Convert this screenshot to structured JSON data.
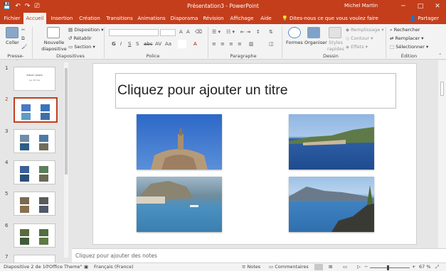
{
  "window": {
    "title": "Présentation3 - PowerPoint",
    "user": "Michel Martin",
    "controls": [
      "─",
      "□",
      "✕"
    ]
  },
  "qat": [
    "💾",
    "↶",
    "↷",
    "⎚"
  ],
  "tabs": [
    {
      "label": "Fichier"
    },
    {
      "label": "Accueil"
    },
    {
      "label": "Insertion"
    },
    {
      "label": "Création"
    },
    {
      "label": "Transitions"
    },
    {
      "label": "Animations"
    },
    {
      "label": "Diaporama"
    },
    {
      "label": "Révision"
    },
    {
      "label": "Affichage"
    },
    {
      "label": "Aide"
    }
  ],
  "tellme": "Dites-nous ce que vous voulez faire",
  "share": "Partager",
  "ribbon": {
    "clipboard": {
      "paste": "Coller",
      "label": "Presse-papiers"
    },
    "slides": {
      "new_slide": "Nouvelle diapositive",
      "layout": "Disposition",
      "reset": "Rétablir",
      "section": "Section",
      "label": "Diapositives"
    },
    "font": {
      "label": "Police",
      "format_row": [
        "G",
        "I",
        "S",
        "S",
        "abc",
        "AV",
        "Aa",
        "A"
      ]
    },
    "paragraph": {
      "label": "Paragraphe"
    },
    "drawing": {
      "shapes": "Formes",
      "arrange": "Organiser",
      "quick_styles": "Styles rapides",
      "fill": "Remplissage",
      "outline": "Contour",
      "effects": "Effets",
      "label": "Dessin"
    },
    "editing": {
      "find": "Rechercher",
      "replace": "Remplacer",
      "select": "Sélectionner",
      "label": "Édition"
    }
  },
  "thumbnails": [
    {
      "num": "1",
      "title": "Album photo",
      "subtitle": "par Michel"
    },
    {
      "num": "2"
    },
    {
      "num": "3"
    },
    {
      "num": "4"
    },
    {
      "num": "5"
    },
    {
      "num": "6"
    },
    {
      "num": "7"
    }
  ],
  "slide": {
    "title_placeholder": "Cliquez pour ajouter un titre"
  },
  "notes_placeholder": "Cliquez pour ajouter des notes",
  "status": {
    "slide_info": "Diapositive 2 de 10",
    "theme": "\"Office Theme\"",
    "language": "Français (France)",
    "notes": "Notes",
    "comments": "Commentaires",
    "zoom_minus": "−",
    "zoom_plus": "+",
    "zoom": "67 %",
    "zoom_fraction": 0.45
  },
  "colors": {
    "accent": "#c43e1c",
    "ribbon": "#f3f3f3"
  }
}
